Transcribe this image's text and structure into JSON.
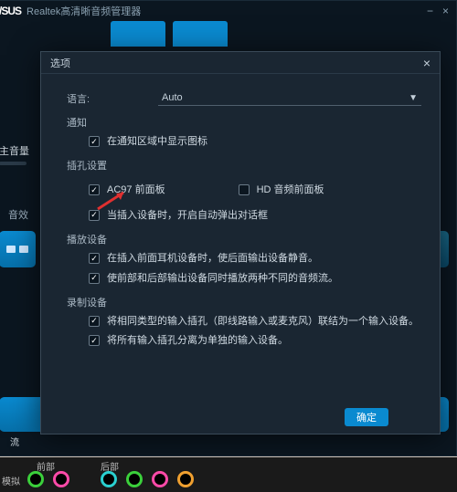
{
  "app": {
    "logo": "/SUS",
    "title": "Realtek高清晰音频管理器"
  },
  "main": {
    "volume_label": "主音量",
    "effect_label": "音效",
    "stream_label": "流"
  },
  "modal": {
    "title": "选项",
    "language_label": "语言:",
    "language_value": "Auto",
    "notify_label": "通知",
    "notify_opt1": "在通知区域中显示图标",
    "jack_label": "插孔设置",
    "jack_opt1": "AC97 前面板",
    "jack_opt2": "HD 音频前面板",
    "jack_popup": "当插入设备时，开启自动弹出对话框",
    "playback_label": "播放设备",
    "playback_opt1": "在插入前面耳机设备时，使后面输出设备静音。",
    "playback_opt2": "使前部和后部输出设备同时播放两种不同的音频流。",
    "record_label": "录制设备",
    "record_opt1": "将相同类型的输入插孔（即线路输入或麦克风）联结为一个输入设备。",
    "record_opt2": "将所有输入插孔分离为单独的输入设备。",
    "ok": "确定"
  },
  "ports": {
    "front": "前部",
    "back": "后部",
    "analog": "模拟"
  }
}
